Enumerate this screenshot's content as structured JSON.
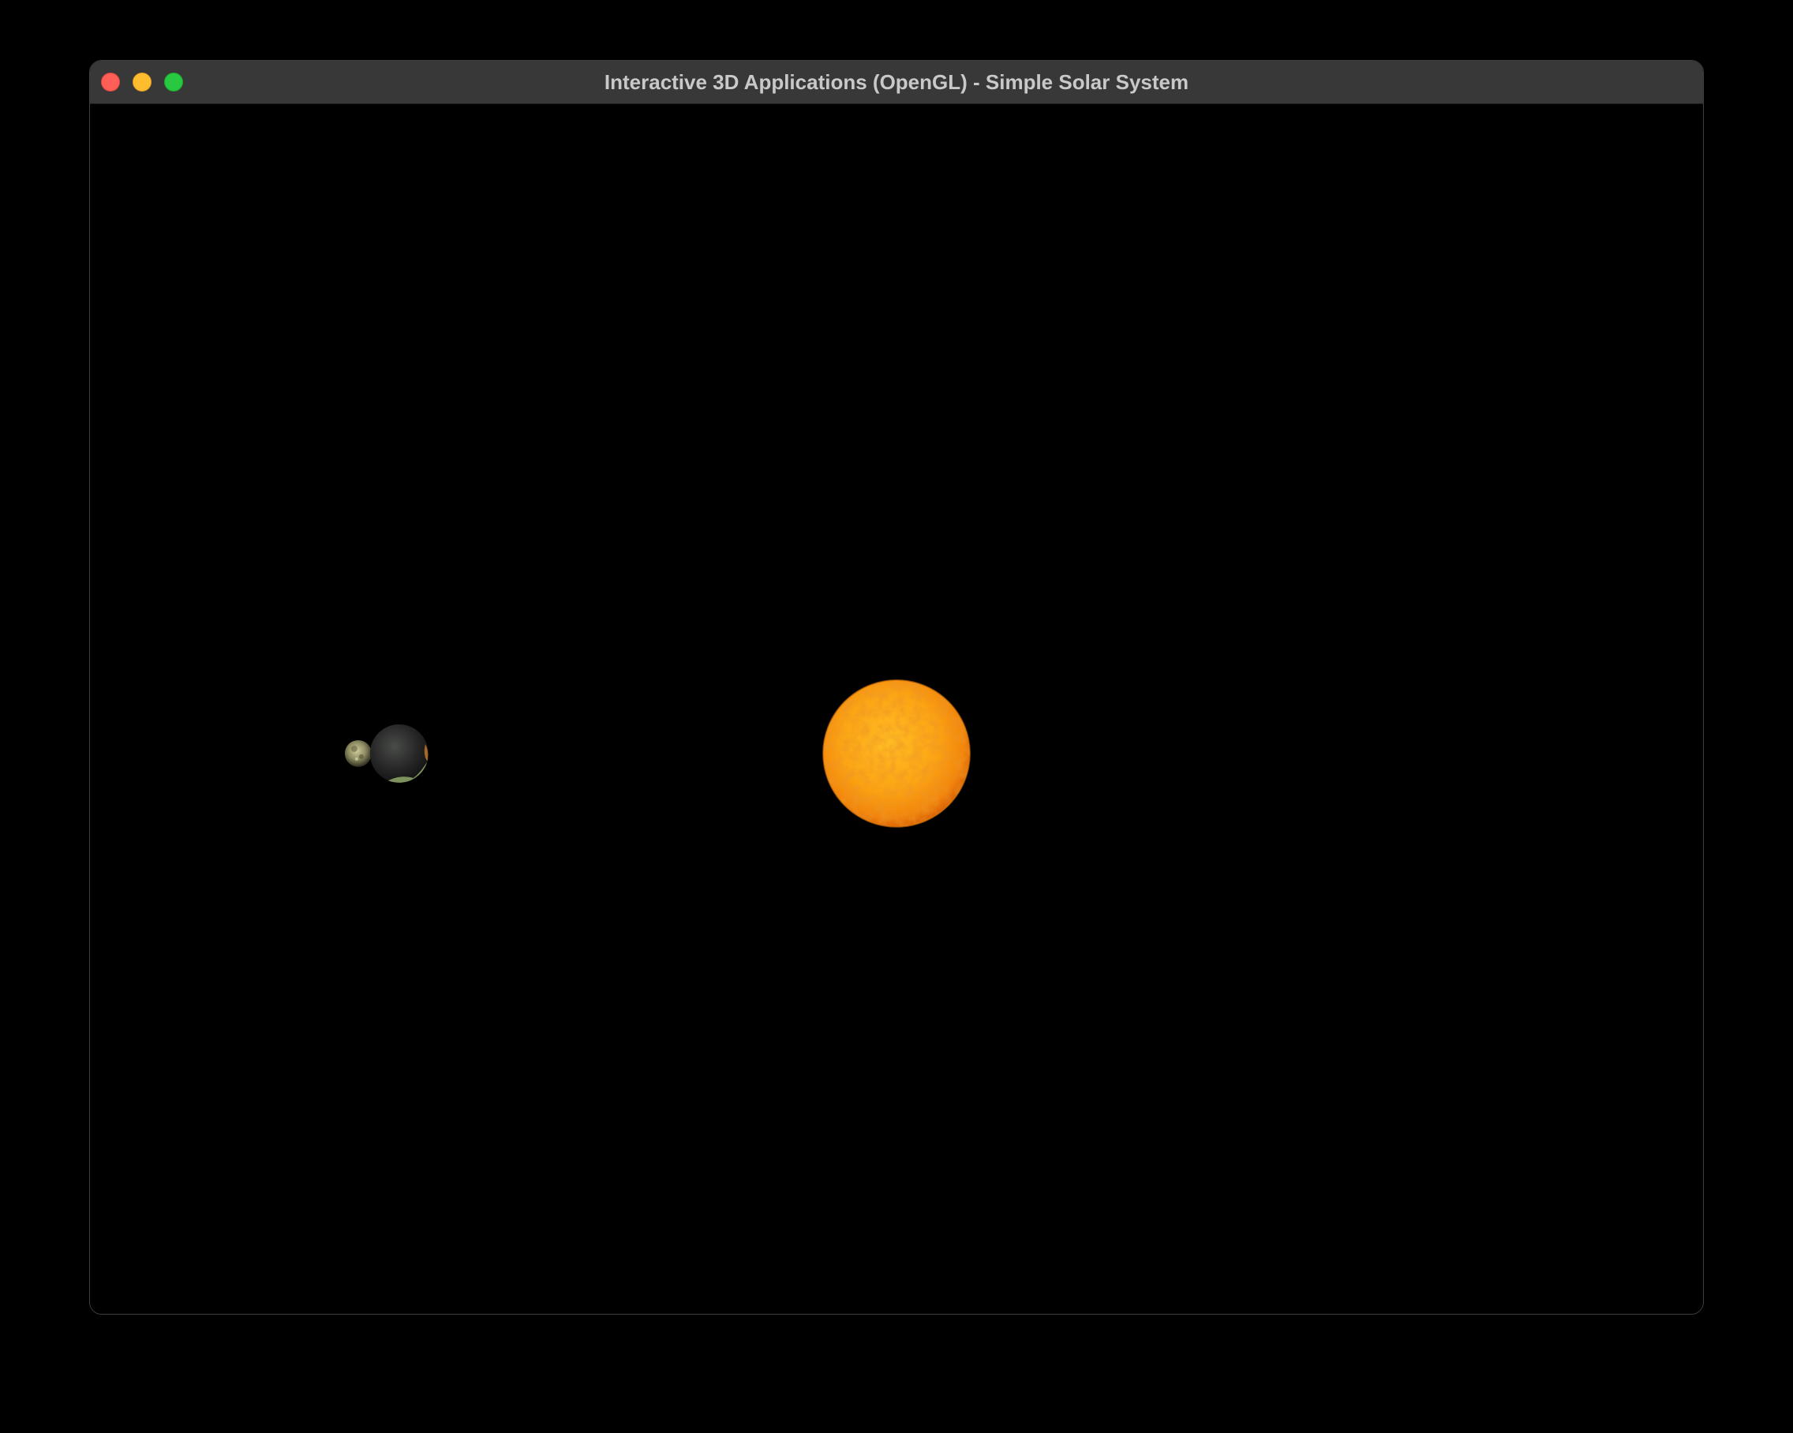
{
  "window": {
    "title": "Interactive 3D Applications (OpenGL) - Simple Solar System",
    "controls": [
      "close",
      "minimize",
      "zoom"
    ]
  },
  "scene": {
    "background_color": "#000000",
    "bodies": [
      {
        "name": "sun",
        "colors": [
          "#ffb31a",
          "#f27a0c",
          "#d44f08"
        ]
      },
      {
        "name": "earth",
        "colors": [
          "#3a3c3a",
          "#1b1c1b",
          "#b7c98a"
        ]
      },
      {
        "name": "moon",
        "colors": [
          "#d8d6a8",
          "#8c8a60",
          "#2c2b1e"
        ]
      }
    ]
  }
}
